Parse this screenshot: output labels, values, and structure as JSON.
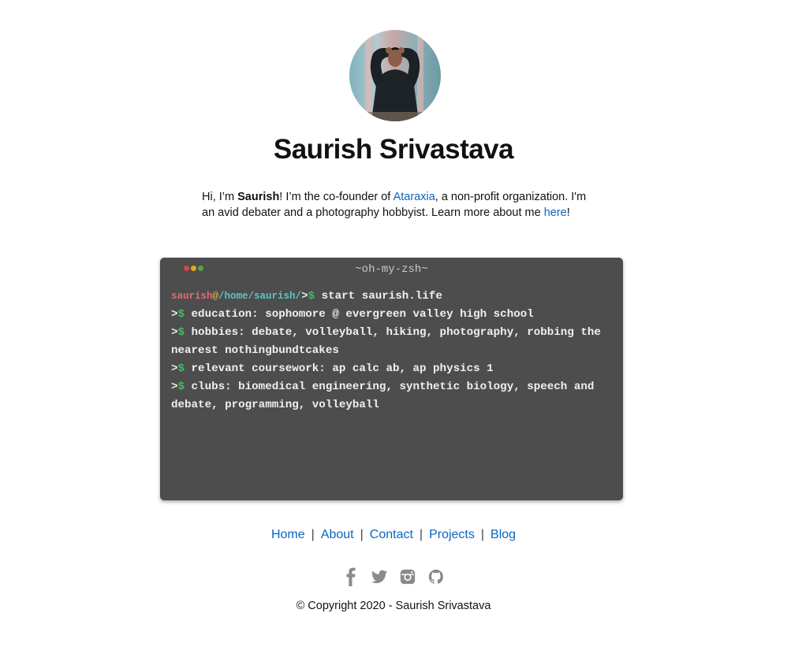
{
  "profile": {
    "name": "Saurish Srivastava",
    "avatar_alt": "profile photo"
  },
  "intro": {
    "greeting": "Hi, I’m ",
    "bold_name": "Saurish",
    "text1": "! I’m the co-founder of ",
    "org_link": "Ataraxia",
    "text2": ", a non-profit organization. I'm an avid debater and a photography hobbyist. Learn more about me ",
    "here_link": "here",
    "text3": "!"
  },
  "terminal": {
    "title": "~oh-my-zsh~",
    "dots": [
      "#e0443e",
      "#e0a92a",
      "#5aa346"
    ],
    "prompt_user": "saurish",
    "prompt_at": "@",
    "prompt_path": "/home/saurish/",
    "prompt_gt": ">",
    "prompt_dollar": "$",
    "command": " start saurish.life",
    "lines": [
      " education: sophomore @ evergreen valley high school",
      " hobbies: debate, volleyball, hiking, photography, robbing the nearest nothingbundtcakes",
      " relevant coursework: ap calc ab, ap physics 1",
      " clubs: biomedical engineering, synthetic biology, speech and debate, programming, volleyball"
    ]
  },
  "nav": {
    "items": [
      "Home",
      "About",
      "Contact",
      "Projects",
      "Blog"
    ],
    "separator": "|"
  },
  "social": {
    "icons": [
      "facebook-icon",
      "twitter-icon",
      "instagram-icon",
      "github-icon"
    ],
    "color": "#8a8a8a"
  },
  "footer": {
    "copyright": "© Copyright 2020 - Saurish Srivastava"
  }
}
